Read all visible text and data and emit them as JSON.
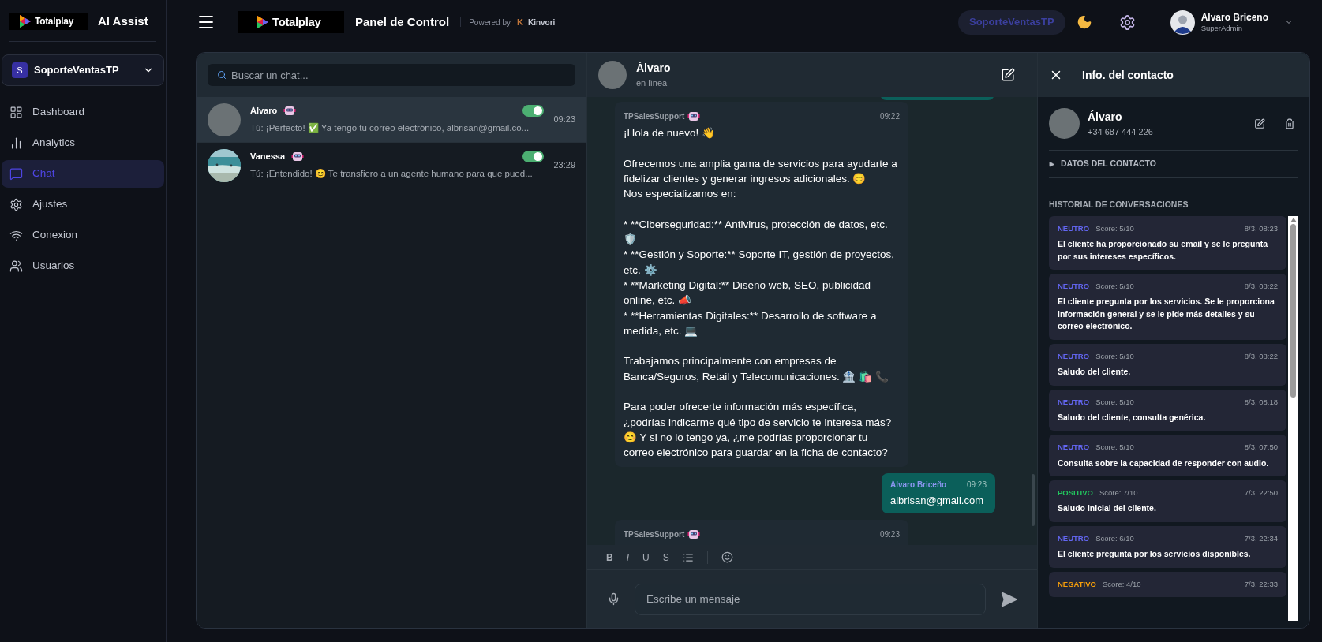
{
  "sidebar": {
    "brand": "Totalplay",
    "title": "AI Assist",
    "workspace": {
      "initial": "S",
      "name": "SoporteVentasTP"
    },
    "items": [
      {
        "label": "Dashboard",
        "selected": false
      },
      {
        "label": "Analytics",
        "selected": false
      },
      {
        "label": "Chat",
        "selected": true
      },
      {
        "label": "Ajustes",
        "selected": false
      },
      {
        "label": "Conexion",
        "selected": false
      },
      {
        "label": "Usuarios",
        "selected": false
      }
    ]
  },
  "header": {
    "brand": "Totalplay",
    "title": "Panel de Control",
    "powered_by": "Powered by",
    "partner_mark": "K",
    "partner": "Kinvori",
    "workspace_pill": "SoporteVentasTP",
    "user": {
      "name": "Alvaro Briceno",
      "role": "SuperAdmin"
    }
  },
  "chat_list": {
    "search": {
      "placeholder": "Buscar un chat..."
    },
    "chats": [
      {
        "name": "Álvaro",
        "preview": "Tú: ¡Perfecto! ✅ Ya tengo tu correo electrónico, albrisan@gmail.co...",
        "time": "09:23",
        "bot_on": true,
        "selected": true,
        "photo": false
      },
      {
        "name": "Vanessa",
        "preview": "Tú: ¡Entendido! 😊 Te transfiero a un agente humano para que pued...",
        "time": "23:29",
        "bot_on": true,
        "selected": false,
        "photo": true
      }
    ]
  },
  "conversation": {
    "contact": {
      "name": "Álvaro",
      "status": "en línea"
    },
    "messages": [
      {
        "kind": "incoming",
        "author": "TPSalesSupport",
        "time": "09:22",
        "text": "¡Hola de nuevo! 👋\n\nOfrecemos una amplia gama de servicios para ayudarte a fidelizar clientes y generar ingresos adicionales. 😊\nNos especializamos en:\n\n*   **Ciberseguridad:** Antivirus, protección de datos, etc. 🛡️\n*   **Gestión y Soporte:** Soporte IT, gestión de proyectos, etc. ⚙️\n*   **Marketing Digital:** Diseño web, SEO, publicidad online, etc. 📣\n*   **Herramientas Digitales:** Desarrollo de software a medida, etc. 💻\n\nTrabajamos principalmente con empresas de Banca/Seguros, Retail y Telecomunicaciones. 🏦 🛍️ 📞\n\nPara poder ofrecerte información más específica, ¿podrías indicarme qué tipo de servicio te interesa más? 😊 Y si no lo tengo ya, ¿me podrías proporcionar tu correo electrónico para guardar en la ficha de contacto?"
      },
      {
        "kind": "outgoing",
        "author": "Álvaro Briceño",
        "time": "09:23",
        "text": "albrisan@gmail.com"
      },
      {
        "kind": "incoming",
        "author": "TPSalesSupport",
        "time": "09:23"
      }
    ],
    "format_buttons": [
      "B",
      "I",
      "U",
      "S"
    ],
    "composer": {
      "placeholder": "Escribe un mensaje"
    }
  },
  "contact_info": {
    "title": "Info. del contacto",
    "name": "Álvaro",
    "phone": "+34 687 444 226",
    "details_section": {
      "label": "DATOS DEL CONTACTO",
      "expanded": false
    },
    "history_title": "HISTORIAL DE CONVERSACIONES",
    "history": [
      {
        "sentiment": "NEUTRO",
        "color": "#6366f1",
        "score": "Score: 5/10",
        "date": "8/3, 08:23",
        "summary": "El cliente ha proporcionado su email y se le pregunta por sus intereses específicos."
      },
      {
        "sentiment": "NEUTRO",
        "color": "#6366f1",
        "score": "Score: 5/10",
        "date": "8/3, 08:22",
        "summary": "El cliente pregunta por los servicios. Se le proporciona información general y se le pide más detalles y su correo electrónico."
      },
      {
        "sentiment": "NEUTRO",
        "color": "#6366f1",
        "score": "Score: 5/10",
        "date": "8/3, 08:22",
        "summary": "Saludo del cliente."
      },
      {
        "sentiment": "NEUTRO",
        "color": "#6366f1",
        "score": "Score: 5/10",
        "date": "8/3, 08:18",
        "summary": "Saludo del cliente, consulta genérica."
      },
      {
        "sentiment": "NEUTRO",
        "color": "#6366f1",
        "score": "Score: 5/10",
        "date": "8/3, 07:50",
        "summary": "Consulta sobre la capacidad de responder con audio."
      },
      {
        "sentiment": "POSITIVO",
        "color": "#22c55e",
        "score": "Score: 7/10",
        "date": "7/3, 22:50",
        "summary": "Saludo inicial del cliente."
      },
      {
        "sentiment": "NEUTRO",
        "color": "#6366f1",
        "score": "Score: 6/10",
        "date": "7/3, 22:34",
        "summary": "El cliente pregunta por los servicios disponibles."
      },
      {
        "sentiment": "NEGATIVO",
        "color": "#f59e0b",
        "score": "Score: 4/10",
        "date": "7/3, 22:33"
      }
    ]
  }
}
